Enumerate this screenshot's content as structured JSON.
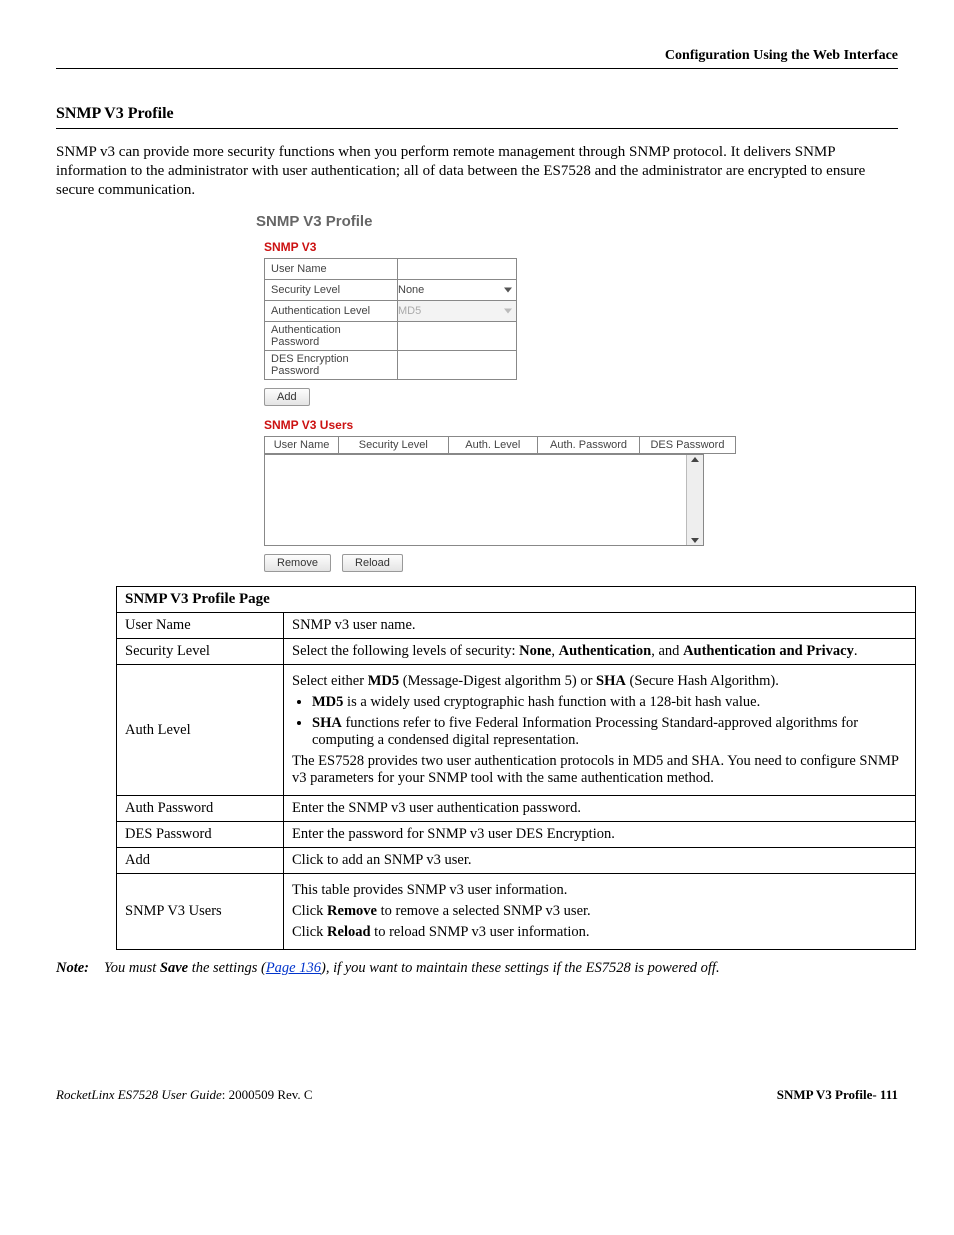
{
  "header": {
    "chapter": "Configuration Using the Web Interface"
  },
  "section": {
    "heading": "SNMP V3 Profile",
    "intro": "SNMP v3 can provide more security functions when you perform remote management through SNMP protocol. It delivers SNMP information to the administrator with user authentication; all of data between the ES7528 and the administrator are encrypted to ensure secure communication."
  },
  "screenshot": {
    "title": "SNMP V3 Profile",
    "section1": "SNMP V3",
    "form": {
      "user_name_label": "User Name",
      "security_level_label": "Security Level",
      "security_level_value": "None",
      "auth_level_label": "Authentication Level",
      "auth_level_value": "MD5",
      "auth_pass_label": "Authentication Password",
      "des_pass_label": "DES Encryption Password"
    },
    "add_btn": "Add",
    "section2": "SNMP V3 Users",
    "columns": {
      "c1": "User Name",
      "c2": "Security Level",
      "c3": "Auth. Level",
      "c4": "Auth. Password",
      "c5": "DES Password"
    },
    "remove_btn": "Remove",
    "reload_btn": "Reload"
  },
  "desc": {
    "title": "SNMP V3 Profile Page",
    "rows": {
      "user_name": {
        "label": "User Name",
        "text": "SNMP v3 user name."
      },
      "security_level": {
        "label": "Security Level",
        "pre": "Select the following levels of security: ",
        "b1": "None",
        "sep1": ", ",
        "b2": "Authentication",
        "sep2": ", and ",
        "b3": "Authentication and Privacy",
        "post": "."
      },
      "auth_level": {
        "label": "Auth Level",
        "line1_pre": "Select either ",
        "line1_b1": "MD5",
        "line1_mid": " (Message-Digest algorithm 5) or ",
        "line1_b2": "SHA",
        "line1_post": " (Secure Hash Algorithm).",
        "bullet1_b": "MD5",
        "bullet1_t": " is a widely used cryptographic hash function with a 128-bit hash value.",
        "bullet2_b": "SHA",
        "bullet2_t": " functions refer to five Federal Information Processing Standard-approved algorithms for computing a condensed digital representation.",
        "para2": "The ES7528 provides two user authentication protocols in MD5 and SHA. You need to configure SNMP v3 parameters for your SNMP tool with the same authentication method."
      },
      "auth_password": {
        "label": "Auth Password",
        "text": "Enter the SNMP v3 user authentication password."
      },
      "des_password": {
        "label": "DES Password",
        "text": "Enter the password for SNMP v3 user DES Encryption."
      },
      "add": {
        "label": "Add",
        "text": "Click to add an SNMP v3 user."
      },
      "users": {
        "label": "SNMP V3 Users",
        "p1": "This table provides SNMP v3 user information.",
        "p2_pre": "Click ",
        "p2_b": "Remove",
        "p2_post": " to remove a selected SNMP v3 user.",
        "p3_pre": "Click ",
        "p3_b": "Reload",
        "p3_post": " to reload SNMP v3 user information."
      }
    }
  },
  "note": {
    "label": "Note:",
    "pre": "You must ",
    "b1": "Save",
    "mid1": " the settings (",
    "link": "Page 136",
    "post": "), if you want to maintain these settings if the ES7528 is powered off."
  },
  "footer": {
    "left_italic": "RocketLinx ES7528  User Guide",
    "left_rest": ": 2000509 Rev. C",
    "right": "SNMP V3 Profile- 111"
  }
}
